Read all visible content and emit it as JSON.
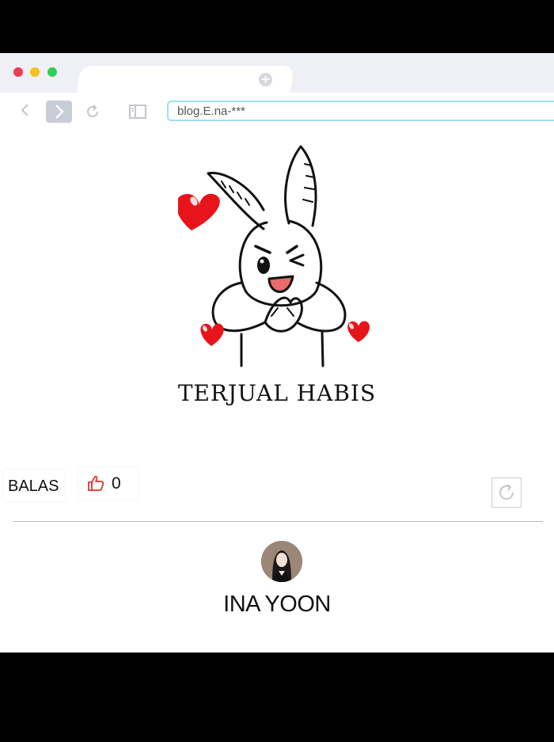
{
  "browser": {
    "new_tab_symbol": "+",
    "address": "blog.E.na-***",
    "icons": [
      "back-icon",
      "forward-icon",
      "reload-icon",
      "sidebar-icon",
      "plus-icon"
    ]
  },
  "post": {
    "image_caption": "TERJUAL HABIS"
  },
  "actions": {
    "reply_label": "BALAS",
    "like_count": "0"
  },
  "author": {
    "name": "INA YOON"
  },
  "colors": {
    "heart": "#e8141b",
    "url_border": "#9de1ec",
    "like_icon": "#e3342f"
  }
}
